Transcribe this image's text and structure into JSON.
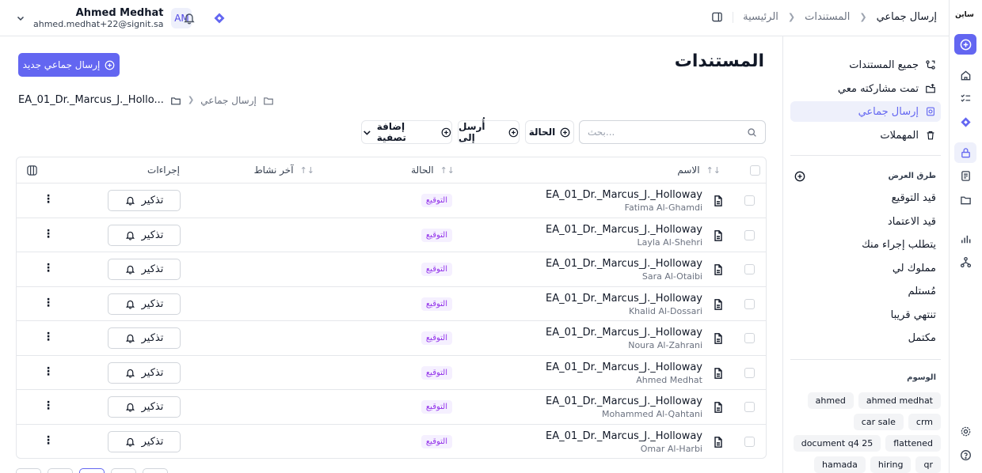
{
  "app": {
    "logo_text": "ساين"
  },
  "header": {
    "breadcrumbs": [
      "الرئيسية",
      "المستندات",
      "إرسال جماعي"
    ],
    "user_name": "Ahmed Medhat",
    "user_email": "ahmed.medhat+22@signit.sa",
    "avatar_initials": "AM"
  },
  "sidebar": {
    "items": [
      {
        "label": "جميع المستندات",
        "icon": "documents-icon"
      },
      {
        "label": "تمت مشاركته معي",
        "icon": "shared-icon"
      },
      {
        "label": "إرسال جماعي",
        "icon": "bulk-send-icon",
        "active": true
      },
      {
        "label": "المهملات",
        "icon": "trash-icon"
      }
    ],
    "views_title": "طرق العرض",
    "views": [
      "قيد التوقيع",
      "قيد الاعتماد",
      "يتطلب إجراء منك",
      "مملوك لي",
      "مُستلم",
      "تنتهي قريبا",
      "مكتمل"
    ],
    "tags_title": "الوسوم",
    "tags": [
      "ahmed",
      "ahmed medhat",
      "car sale",
      "crm",
      "document q4 25",
      "flattened",
      "hamada",
      "hiring",
      "qr"
    ]
  },
  "main": {
    "title": "المستندات",
    "new_button": "إرسال جماعي جديد",
    "path_root": "إرسال جماعي",
    "path_current": "EA_01_Dr._Marcus_J._Hollo...",
    "search_placeholder": "بحث...",
    "filters": {
      "status": "الحالة",
      "sent_to": "أُرسل إلى",
      "add_filter": "إضافة تصفية"
    },
    "columns": {
      "name": "الاسم",
      "status": "الحالة",
      "last_activity": "آخر نشاط",
      "actions": "إجراءات"
    },
    "rows": [
      {
        "title": "EA_01_Dr._Marcus_J._Holloway",
        "recipient": "Fatima Al-Ghamdi",
        "status": "التوقيع",
        "action": "تذكير"
      },
      {
        "title": "EA_01_Dr._Marcus_J._Holloway",
        "recipient": "Layla Al-Shehri",
        "status": "التوقيع",
        "action": "تذكير"
      },
      {
        "title": "EA_01_Dr._Marcus_J._Holloway",
        "recipient": "Sara Al-Otaibi",
        "status": "التوقيع",
        "action": "تذكير"
      },
      {
        "title": "EA_01_Dr._Marcus_J._Holloway",
        "recipient": "Khalid Al-Dossari",
        "status": "التوقيع",
        "action": "تذكير"
      },
      {
        "title": "EA_01_Dr._Marcus_J._Holloway",
        "recipient": "Noura Al-Zahrani",
        "status": "التوقيع",
        "action": "تذكير"
      },
      {
        "title": "EA_01_Dr._Marcus_J._Holloway",
        "recipient": "Ahmed Medhat",
        "status": "التوقيع",
        "action": "تذكير"
      },
      {
        "title": "EA_01_Dr._Marcus_J._Holloway",
        "recipient": "Mohammed Al-Qahtani",
        "status": "التوقيع",
        "action": "تذكير"
      },
      {
        "title": "EA_01_Dr._Marcus_J._Holloway",
        "recipient": "Omar Al-Harbi",
        "status": "التوقيع",
        "action": "تذكير"
      }
    ]
  },
  "colors": {
    "accent": "#6366f1",
    "status_text": "#9333ea",
    "status_bg": "#f5f0ff"
  }
}
